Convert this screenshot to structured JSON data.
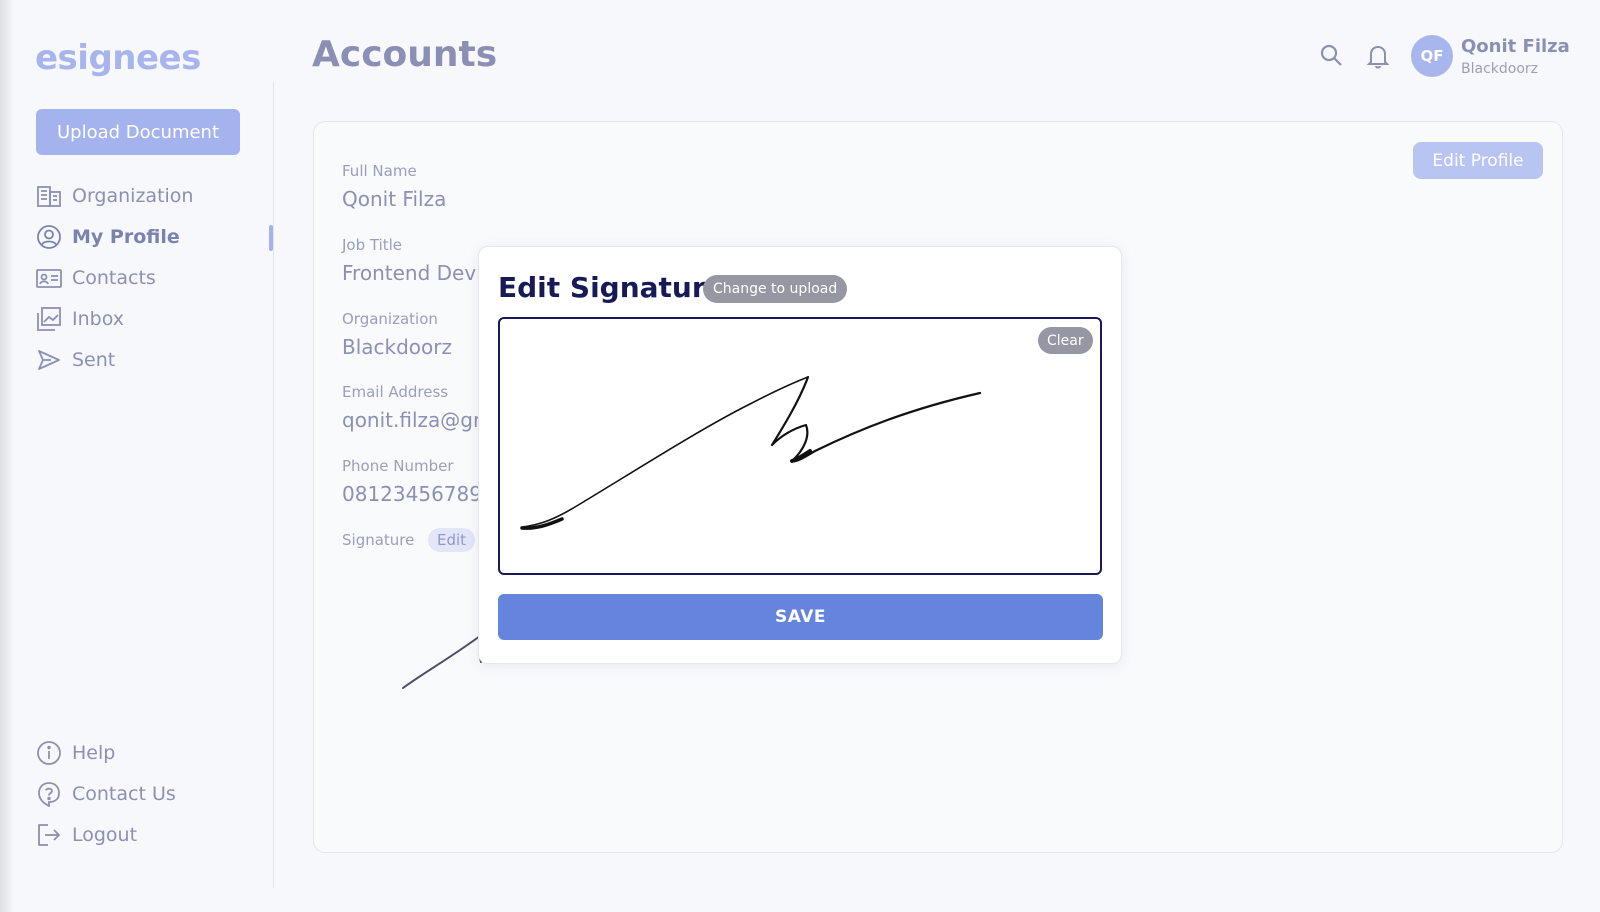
{
  "app": {
    "logo": "esignees",
    "upload_label": "Upload Document"
  },
  "sidebar": {
    "items": [
      {
        "label": "Organization",
        "icon": "building-icon"
      },
      {
        "label": "My Profile",
        "icon": "user-circle-icon",
        "active": true
      },
      {
        "label": "Contacts",
        "icon": "id-card-icon"
      },
      {
        "label": "Inbox",
        "icon": "inbox-images-icon"
      },
      {
        "label": "Sent",
        "icon": "send-icon"
      }
    ],
    "bottom_items": [
      {
        "label": "Help",
        "icon": "info-icon"
      },
      {
        "label": "Contact Us",
        "icon": "question-icon"
      },
      {
        "label": "Logout",
        "icon": "logout-icon"
      }
    ]
  },
  "header": {
    "title": "Accounts",
    "user": {
      "initials": "QF",
      "name": "Qonit Filza",
      "org": "Blackdoorz"
    }
  },
  "profile": {
    "edit_label": "Edit Profile",
    "fields": [
      {
        "label": "Full Name",
        "value": "Qonit Filza"
      },
      {
        "label": "Job Title",
        "value": "Frontend Dev"
      },
      {
        "label": "Organization",
        "value": "Blackdoorz"
      },
      {
        "label": "Email Address",
        "value": "qonit.filza@gr"
      },
      {
        "label": "Phone Number",
        "value": "08123456789"
      }
    ],
    "signature_label": "Signature",
    "signature_edit": "Edit"
  },
  "modal": {
    "title": "Edit Signature",
    "change_label": "Change to upload",
    "clear_label": "Clear",
    "save_label": "SAVE"
  },
  "colors": {
    "accent": "#6585dd",
    "accent_light": "#a4b2ee",
    "title_dark": "#171a57",
    "muted_text": "#8c90b3",
    "pill_gray": "#9597a3"
  }
}
